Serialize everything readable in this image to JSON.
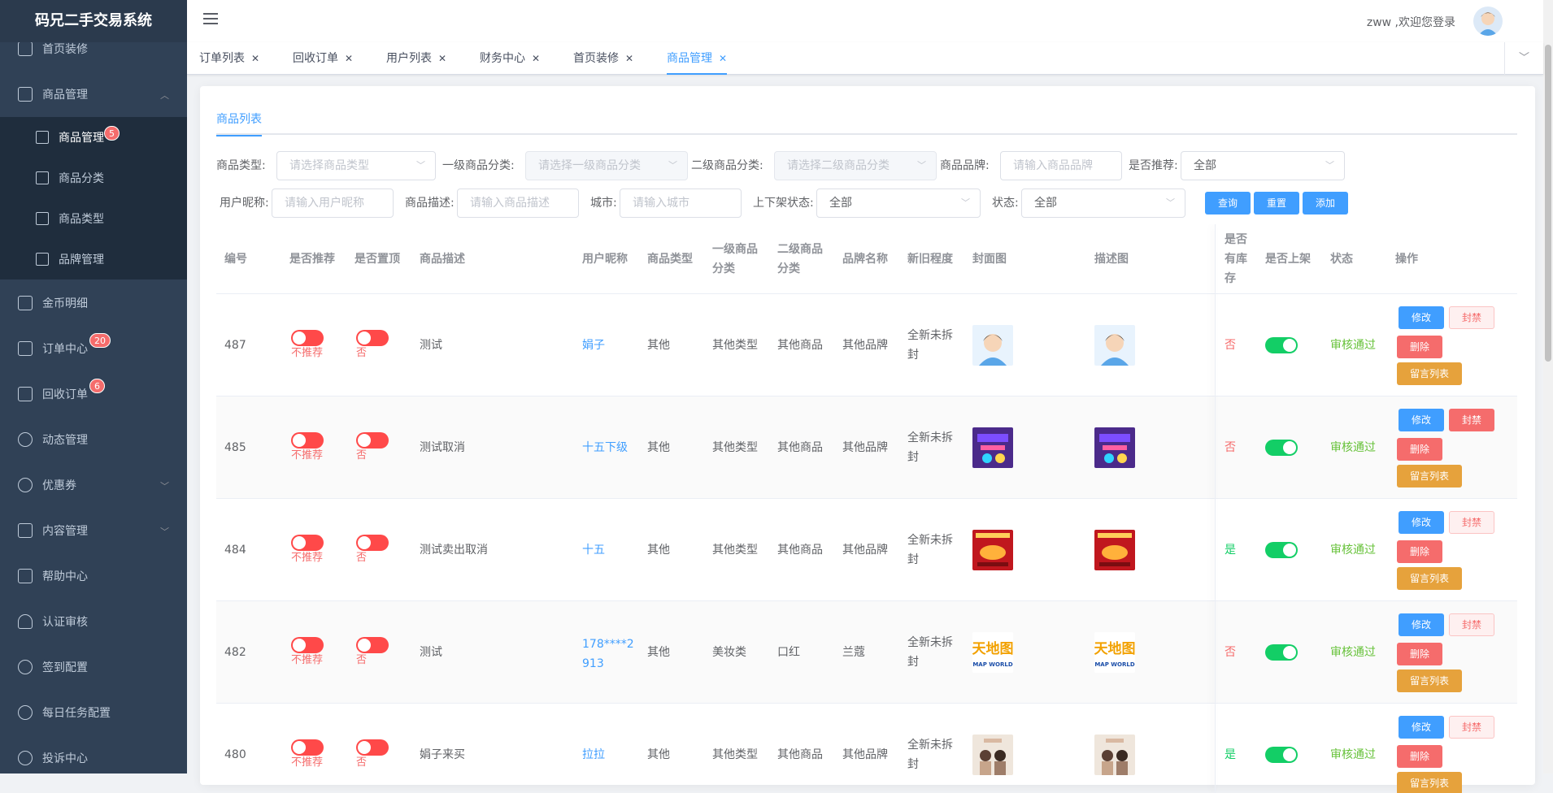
{
  "app": {
    "title": "码兄二手交易系统"
  },
  "sidebar": {
    "items": [
      {
        "label": "首页装修",
        "icon": "cube-icon"
      },
      {
        "label": "商品管理",
        "icon": "cube-icon",
        "expanded": true
      },
      {
        "label": "金币明细",
        "icon": "clipboard-icon"
      },
      {
        "label": "订单中心",
        "icon": "clipboard-icon",
        "badge": "20"
      },
      {
        "label": "回收订单",
        "icon": "list-icon",
        "badge": "6"
      },
      {
        "label": "动态管理",
        "icon": "pie-icon"
      },
      {
        "label": "优惠券",
        "icon": "coins-icon"
      },
      {
        "label": "内容管理",
        "icon": "table-icon"
      },
      {
        "label": "帮助中心",
        "icon": "list-icon"
      },
      {
        "label": "认证审核",
        "icon": "user-icon"
      },
      {
        "label": "签到配置",
        "icon": "clock-icon"
      },
      {
        "label": "每日任务配置",
        "icon": "pie-icon"
      },
      {
        "label": "投诉中心",
        "icon": "pie-icon"
      }
    ],
    "sub_items": [
      {
        "label": "商品管理",
        "badge": "5",
        "active": true
      },
      {
        "label": "商品分类"
      },
      {
        "label": "商品类型"
      },
      {
        "label": "品牌管理"
      }
    ]
  },
  "navbar": {
    "welcome": "zww ,欢迎您登录"
  },
  "tags": [
    {
      "label": "订单列表"
    },
    {
      "label": "回收订单"
    },
    {
      "label": "用户列表"
    },
    {
      "label": "财务中心"
    },
    {
      "label": "首页装修"
    },
    {
      "label": "商品管理",
      "active": true
    }
  ],
  "page": {
    "subtab": "商品列表"
  },
  "filters": {
    "type_label": "商品类型:",
    "type_ph": "请选择商品类型",
    "cat1_label": "一级商品分类:",
    "cat1_ph": "请选择一级商品分类",
    "cat2_label": "二级商品分类:",
    "cat2_ph": "请选择二级商品分类",
    "brand_label": "商品品牌:",
    "brand_ph": "请输入商品品牌",
    "rec_label": "是否推荐:",
    "rec_val": "全部",
    "nick_label": "用户昵称:",
    "nick_ph": "请输入用户昵称",
    "desc_label": "商品描述:",
    "desc_ph": "请输入商品描述",
    "city_label": "城市:",
    "city_ph": "请输入城市",
    "shelf_label": "上下架状态:",
    "shelf_val": "全部",
    "status_label": "状态:",
    "status_val": "全部",
    "query": "查询",
    "reset": "重置",
    "add": "添加"
  },
  "table": {
    "headers": {
      "id": "编号",
      "rec": "是否推荐",
      "top": "是否置顶",
      "desc": "商品描述",
      "nick": "用户昵称",
      "type": "商品类型",
      "cat1_a": "一级商品",
      "cat1_b": "分类",
      "cat2_a": "二级商品",
      "cat2_b": "分类",
      "brand": "品牌名称",
      "cond": "新旧程度",
      "cover": "封面图",
      "img": "描述图",
      "stock_a": "是否",
      "stock_b": "有库",
      "stock_c": "存",
      "shelf": "是否上架",
      "status": "状态",
      "op": "操作"
    },
    "rows": [
      {
        "id": "487",
        "rec": "不推荐",
        "top": "否",
        "desc": "测试",
        "nick": "娟子",
        "nick2": "",
        "type": "其他",
        "cat1": "其他类型",
        "cat2": "其他商品",
        "brand": "其他品牌",
        "cond1": "全新未拆",
        "cond2": "封",
        "img": "avatar",
        "stock": "否",
        "status": "审核通过",
        "ban_solid": false
      },
      {
        "id": "485",
        "rec": "不推荐",
        "top": "否",
        "desc": "测试取消",
        "nick": "十五下级",
        "nick2": "",
        "type": "其他",
        "cat1": "其他类型",
        "cat2": "其他商品",
        "brand": "其他品牌",
        "cond1": "全新未拆",
        "cond2": "封",
        "img": "purple",
        "stock": "否",
        "status": "审核通过",
        "ban_solid": true
      },
      {
        "id": "484",
        "rec": "不推荐",
        "top": "否",
        "desc": "测试卖出取消",
        "nick": "十五",
        "nick2": "",
        "type": "其他",
        "cat1": "其他类型",
        "cat2": "其他商品",
        "brand": "其他品牌",
        "cond1": "全新未拆",
        "cond2": "封",
        "img": "red",
        "stock": "是",
        "status": "审核通过",
        "ban_solid": false
      },
      {
        "id": "482",
        "rec": "不推荐",
        "top": "否",
        "desc": "测试",
        "nick": "178****2",
        "nick2": "913",
        "type": "其他",
        "cat1": "美妆类",
        "cat2": "口红",
        "brand": "兰蔻",
        "cond1": "全新未拆",
        "cond2": "封",
        "img": "logo",
        "stock": "否",
        "status": "审核通过",
        "ban_solid": false
      },
      {
        "id": "480",
        "rec": "不推荐",
        "top": "否",
        "desc": "娟子来买",
        "nick": "拉拉",
        "nick2": "",
        "type": "其他",
        "cat1": "其他类型",
        "cat2": "其他商品",
        "brand": "其他品牌",
        "cond1": "全新未拆",
        "cond2": "封",
        "img": "photo",
        "stock": "是",
        "status": "审核通过",
        "ban_solid": false
      }
    ],
    "op_edit": "修改",
    "op_ban": "封禁",
    "op_delete": "删除",
    "op_comments": "留言列表",
    "logo_text_cn": "天地图",
    "logo_text_en": "MAP WORLD"
  },
  "colors": {
    "sidebar_bg": "#304156",
    "primary": "#409eff",
    "danger": "#f56c6c",
    "success": "#13ce66",
    "warning": "#e6a23c"
  }
}
